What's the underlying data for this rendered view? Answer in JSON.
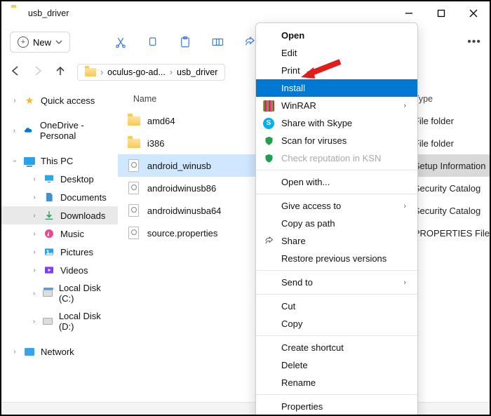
{
  "titlebar": {
    "title": "usb_driver"
  },
  "toolbar": {
    "new_label": "New"
  },
  "nav": {
    "crumb1": "oculus-go-ad...",
    "crumb2": "usb_driver"
  },
  "sidebar": {
    "quick_access": "Quick access",
    "onedrive": "OneDrive - Personal",
    "this_pc": "This PC",
    "desktop": "Desktop",
    "documents": "Documents",
    "downloads": "Downloads",
    "music": "Music",
    "pictures": "Pictures",
    "videos": "Videos",
    "disk_c": "Local Disk (C:)",
    "disk_d": "Local Disk (D:)",
    "network": "Network"
  },
  "columns": {
    "name": "Name",
    "type": "Type"
  },
  "files": [
    {
      "name": "amd64",
      "type": "File folder",
      "icon": "folder"
    },
    {
      "name": "i386",
      "type": "File folder",
      "icon": "folder"
    },
    {
      "name": "android_winusb",
      "type": "Setup Information",
      "icon": "inf",
      "selected": true
    },
    {
      "name": "androidwinusb86",
      "type": "Security Catalog",
      "icon": "inf"
    },
    {
      "name": "androidwinusba64",
      "type": "Security Catalog",
      "icon": "inf"
    },
    {
      "name": "source.properties",
      "type": "PROPERTIES File",
      "icon": "inf"
    }
  ],
  "ctx": {
    "open": "Open",
    "edit": "Edit",
    "print": "Print",
    "install": "Install",
    "winrar": "WinRAR",
    "skype": "Share with Skype",
    "scan": "Scan for viruses",
    "ksn": "Check reputation in KSN",
    "open_with": "Open with...",
    "give_access": "Give access to",
    "copy_path": "Copy as path",
    "share": "Share",
    "restore": "Restore previous versions",
    "send_to": "Send to",
    "cut": "Cut",
    "copy": "Copy",
    "shortcut": "Create shortcut",
    "delete": "Delete",
    "rename": "Rename",
    "properties": "Properties"
  }
}
